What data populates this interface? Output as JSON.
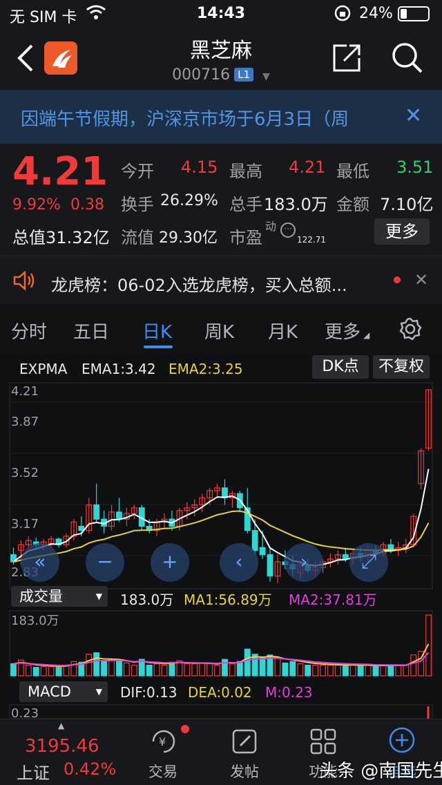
{
  "status": {
    "carrier": "无 SIM 卡",
    "time": "14:43",
    "battery": "24%"
  },
  "header": {
    "title": "黑芝麻",
    "code": "000716",
    "level_badge": "L1"
  },
  "banner": {
    "text": "因端午节假期，沪深京市场于6月3日（周"
  },
  "quote": {
    "price": "4.21",
    "pct": "9.92%",
    "change": "0.38",
    "labels": {
      "open": "今开",
      "high": "最高",
      "low": "最低",
      "turnover": "换手",
      "volume": "总手",
      "amount": "金额",
      "total_value": "总值",
      "float_value": "流值",
      "pe": "市盈",
      "pe_sup": "动"
    },
    "open": "4.15",
    "high": "4.21",
    "low": "3.51",
    "turnover": "26.29%",
    "volume": "183.0万",
    "amount": "7.10亿",
    "total_value": "31.32亿",
    "float_value": "29.30亿",
    "pe": "122.71",
    "more": "更多"
  },
  "notice": {
    "text": "龙虎榜：06-02入选龙虎榜，买入总额..."
  },
  "tabs": [
    "分时",
    "五日",
    "日K",
    "周K",
    "月K",
    "更多"
  ],
  "active_tab": 2,
  "indicator": {
    "expma_label": "EXPMA",
    "ema1": "EMA1:3.42",
    "ema2": "EMA2:3.25",
    "dk_btn": "DK点",
    "fq_btn": "不复权",
    "vol_selector": "成交量",
    "vol_total": "183.0万",
    "vol_ma1": "MA1:56.89万",
    "vol_ma2": "MA2:37.81万",
    "vol_axis_max": "183.0万",
    "macd_selector": "MACD",
    "dif": "DIF:0.13",
    "dea": "DEA:0.02",
    "m": "M:0.23",
    "macd_axis": "0.23"
  },
  "chart_data": {
    "type": "candlestick",
    "price_ticks": [
      "4.21",
      "3.87",
      "3.52",
      "3.17",
      "2.83"
    ],
    "ylim": [
      2.83,
      4.21
    ],
    "candles": [
      [
        3.05,
        3.1,
        2.98,
        3.0
      ],
      [
        3.08,
        3.15,
        2.98,
        3.12
      ],
      [
        3.12,
        3.18,
        3.08,
        3.15
      ],
      [
        3.14,
        3.17,
        3.1,
        3.12
      ],
      [
        3.12,
        3.16,
        3.08,
        3.14
      ],
      [
        3.13,
        3.18,
        3.1,
        3.16
      ],
      [
        3.16,
        3.17,
        3.1,
        3.12
      ],
      [
        3.12,
        3.2,
        3.1,
        3.18
      ],
      [
        3.18,
        3.3,
        3.15,
        3.28
      ],
      [
        3.25,
        3.32,
        3.18,
        3.22
      ],
      [
        3.22,
        3.45,
        3.2,
        3.4
      ],
      [
        3.4,
        3.55,
        3.28,
        3.3
      ],
      [
        3.3,
        3.36,
        3.2,
        3.25
      ],
      [
        3.25,
        3.4,
        3.22,
        3.35
      ],
      [
        3.35,
        3.45,
        3.28,
        3.3
      ],
      [
        3.3,
        3.38,
        3.25,
        3.34
      ],
      [
        3.34,
        3.4,
        3.3,
        3.38
      ],
      [
        3.38,
        3.4,
        3.22,
        3.25
      ],
      [
        3.25,
        3.3,
        3.2,
        3.22
      ],
      [
        3.22,
        3.3,
        3.18,
        3.28
      ],
      [
        3.28,
        3.34,
        3.24,
        3.3
      ],
      [
        3.3,
        3.36,
        3.22,
        3.25
      ],
      [
        3.25,
        3.38,
        3.22,
        3.36
      ],
      [
        3.36,
        3.42,
        3.3,
        3.38
      ],
      [
        3.38,
        3.44,
        3.32,
        3.4
      ],
      [
        3.4,
        3.48,
        3.35,
        3.45
      ],
      [
        3.45,
        3.52,
        3.4,
        3.5
      ],
      [
        3.5,
        3.55,
        3.45,
        3.52
      ],
      [
        3.52,
        3.58,
        3.4,
        3.45
      ],
      [
        3.45,
        3.5,
        3.38,
        3.48
      ],
      [
        3.48,
        3.5,
        3.35,
        3.38
      ],
      [
        3.38,
        3.52,
        3.2,
        3.22
      ],
      [
        3.22,
        3.3,
        3.05,
        3.08
      ],
      [
        3.1,
        3.22,
        3.02,
        3.05
      ],
      [
        3.05,
        3.1,
        2.86,
        2.9
      ],
      [
        2.9,
        3.05,
        2.85,
        3.0
      ],
      [
        3.0,
        3.08,
        2.95,
        2.98
      ],
      [
        2.98,
        3.05,
        2.9,
        2.95
      ],
      [
        2.92,
        3.0,
        2.88,
        2.98
      ],
      [
        2.98,
        3.02,
        2.92,
        2.94
      ],
      [
        2.94,
        3.0,
        2.9,
        2.96
      ],
      [
        2.96,
        3.02,
        2.92,
        3.0
      ],
      [
        3.0,
        3.06,
        2.96,
        3.02
      ],
      [
        3.02,
        3.08,
        2.98,
        3.05
      ],
      [
        3.05,
        3.1,
        3.0,
        3.02
      ],
      [
        3.02,
        3.08,
        2.98,
        3.06
      ],
      [
        3.06,
        3.1,
        3.0,
        3.04
      ],
      [
        3.04,
        3.1,
        3.0,
        3.08
      ],
      [
        3.08,
        3.12,
        3.04,
        3.06
      ],
      [
        3.06,
        3.14,
        3.04,
        3.12
      ],
      [
        3.12,
        3.16,
        3.06,
        3.08
      ],
      [
        3.08,
        3.14,
        3.04,
        3.1
      ],
      [
        3.1,
        3.16,
        3.06,
        3.12
      ],
      [
        3.12,
        3.34,
        3.1,
        3.32
      ],
      [
        3.55,
        3.8,
        3.51,
        3.78
      ],
      [
        3.8,
        4.21,
        3.78,
        4.21
      ]
    ],
    "volume_max": 183.0
  },
  "footer": {
    "index_value": "3195.46",
    "index_name": "上证",
    "index_pct": "0.42%",
    "nav": [
      "交易",
      "发帖",
      "功能",
      "自选"
    ],
    "watermark": "头条 @南国先生"
  },
  "colors": {
    "up": "#f23a3a",
    "down": "#2fd6d6",
    "ema1": "#ffffff",
    "ema2": "#e8d33a",
    "ma2": "#e23ee0",
    "accent": "#3d8ef0"
  }
}
